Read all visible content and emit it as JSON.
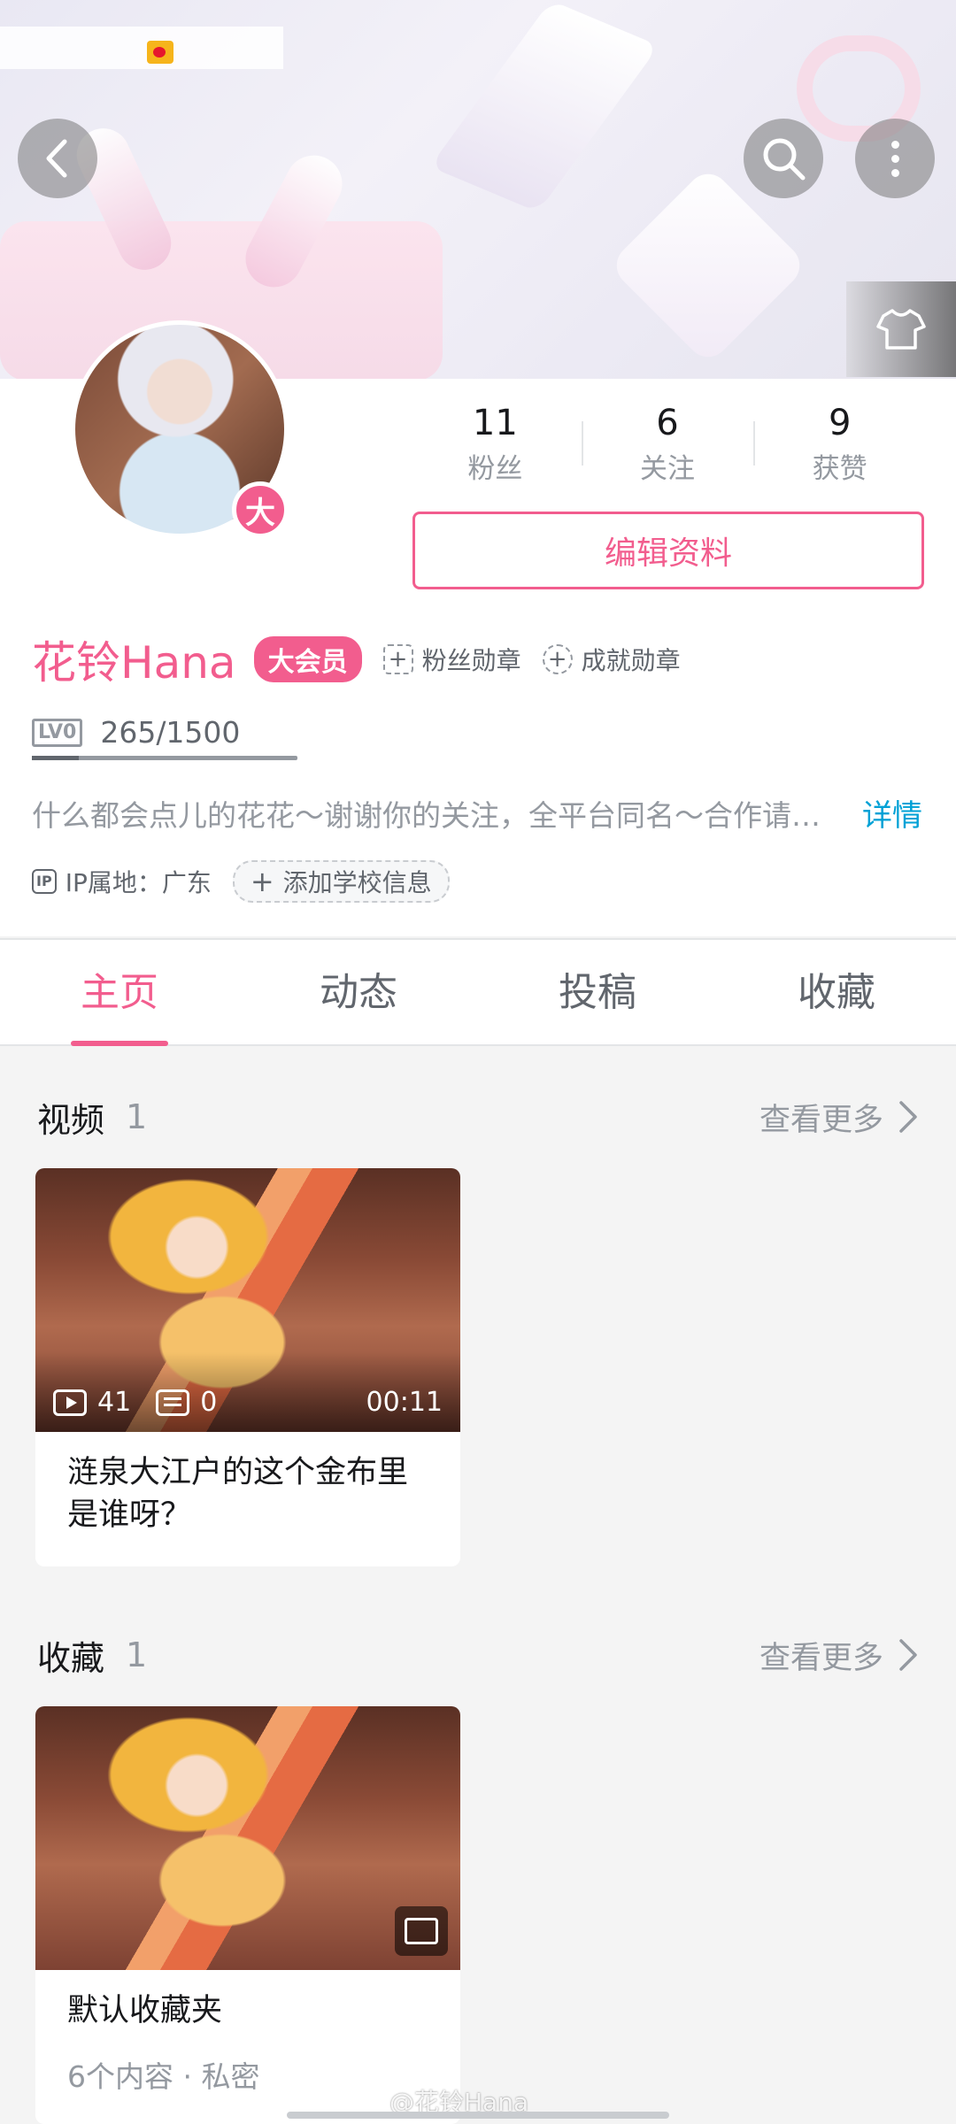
{
  "stats": [
    {
      "num": "11",
      "label": "粉丝"
    },
    {
      "num": "6",
      "label": "关注"
    },
    {
      "num": "9",
      "label": "获赞"
    }
  ],
  "edit_button": "编辑资料",
  "avatar_badge": "大",
  "user": {
    "name": "花铃Hana",
    "vip_label": "大会员",
    "fan_medal": "粉丝勋章",
    "achievement_medal": "成就勋章",
    "level_label": "LV0",
    "exp": "265/1500",
    "exp_progress": 0.1767,
    "bio": "什么都会点儿的花花～谢谢你的关注，全平台同名～合作请私信",
    "detail_link": "详情",
    "ip_icon": "IP",
    "ip_location": "IP属地：广东",
    "add_school": "添加学校信息"
  },
  "tabs": [
    {
      "label": "主页",
      "active": true
    },
    {
      "label": "动态",
      "active": false
    },
    {
      "label": "投稿",
      "active": false
    },
    {
      "label": "收藏",
      "active": false
    }
  ],
  "videos_section": {
    "title": "视频",
    "count": "1",
    "more": "查看更多",
    "card": {
      "plays": "41",
      "danmaku": "0",
      "duration": "00:11",
      "title": "涟泉大江户的这个金布里是谁呀？"
    }
  },
  "favorites_section": {
    "title": "收藏",
    "count": "1",
    "more": "查看更多",
    "card": {
      "title": "默认收藏夹",
      "subtitle": "6个内容 · 私密"
    }
  },
  "watermark": "@花铃Hana",
  "colors": {
    "brand_pink": "#f25d8e",
    "link_blue": "#00a1d6"
  },
  "icons": [
    "back-arrow-icon",
    "search-icon",
    "more-vertical-icon",
    "tshirt-icon",
    "ip-icon",
    "chevron-right-icon",
    "play-count-icon",
    "danmaku-icon",
    "favorite-folder-icon",
    "weibo-icon"
  ]
}
